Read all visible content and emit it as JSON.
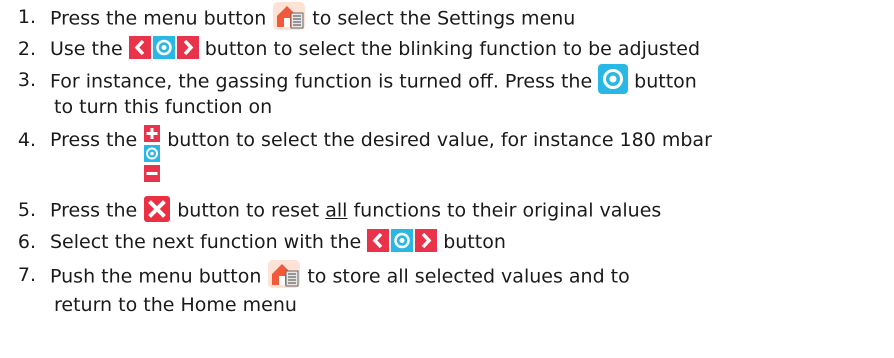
{
  "steps": [
    {
      "num": "1.",
      "before": "Press the menu button",
      "icon": "menu-home-icon",
      "after": "to select the Settings menu"
    },
    {
      "num": "2.",
      "before": "Use the",
      "icon": "nav-left-ok-right-icon",
      "after": "button to select the blinking function to be adjusted"
    },
    {
      "num": "3.",
      "before": "For instance, the gassing function is turned off. Press the",
      "icon": "ok-circle-icon",
      "after": "button",
      "line2": "to turn this function on"
    },
    {
      "num": "4.",
      "before": "Press the",
      "icon": "plus-minus-icon",
      "after": "button to select the desired value, for instance 180 mbar"
    },
    {
      "num": "5.",
      "before": "Press the",
      "icon": "reset-x-icon",
      "after_pre": "button to reset",
      "after_underlined": "all",
      "after_post": "functions to their original values"
    },
    {
      "num": "6.",
      "before": "Select the next function with the",
      "icon": "nav-left-ok-right-icon",
      "after": "button"
    },
    {
      "num": "7.",
      "before": "Push the menu button",
      "icon": "menu-home-icon",
      "after": "to store all selected values and to",
      "line2": "return to the Home menu"
    }
  ],
  "colors": {
    "nav_red": "#e8334a",
    "nav_blue": "#29b7e6",
    "menu_orange": "#f05a3a",
    "reset_red": "#ea3042"
  }
}
